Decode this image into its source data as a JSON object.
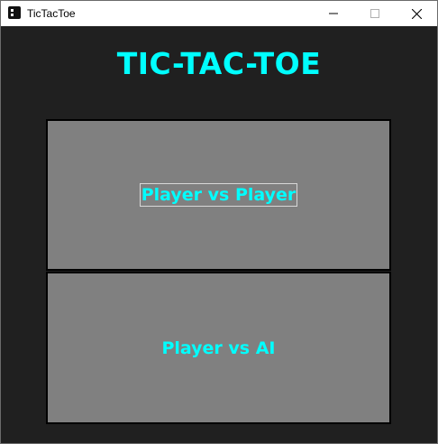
{
  "window": {
    "title": "TicTacToe",
    "app_icon": "dice-icon",
    "controls": {
      "minimize_icon": "minimize-icon",
      "maximize_icon": "maximize-icon",
      "close_icon": "close-icon"
    }
  },
  "game": {
    "title": "TIC-TAC-TOE",
    "title_color": "#00ffff",
    "background_color": "#202020",
    "buttons": [
      {
        "label": "Player vs Player",
        "focused": true
      },
      {
        "label": "Player vs AI",
        "focused": false
      }
    ],
    "button_color": "#808080",
    "button_text_color": "#00ffff"
  }
}
